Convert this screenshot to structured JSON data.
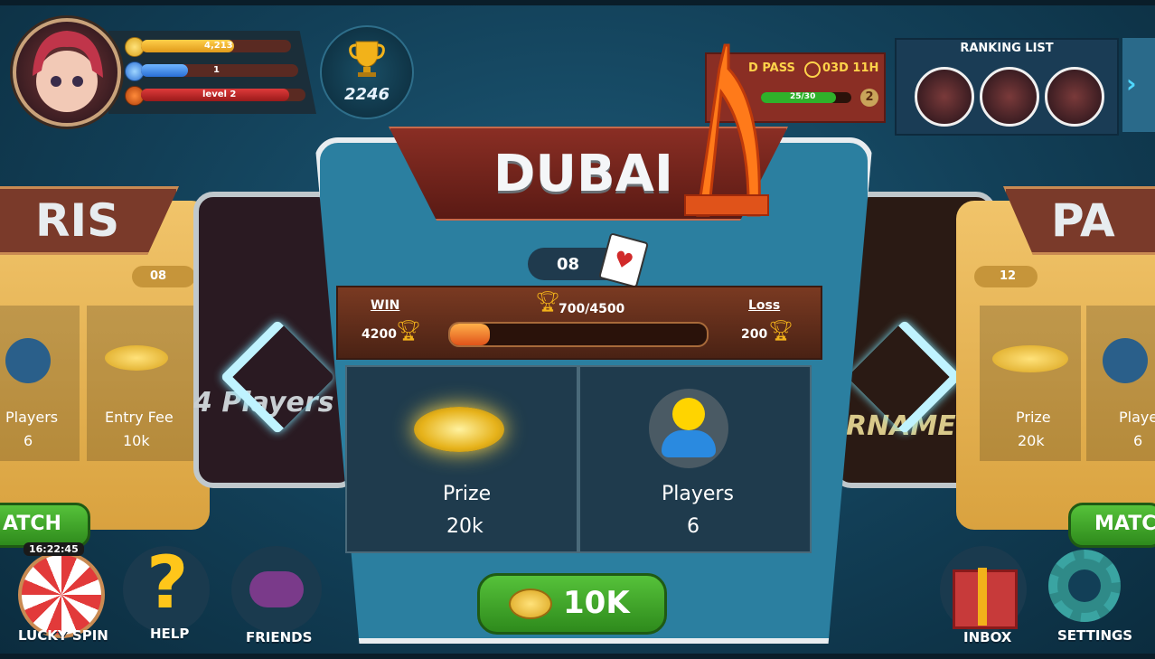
{
  "profile": {
    "coins": "4,213",
    "gems": "1",
    "level": "level 2",
    "trophies": "2246",
    "coin_progress": 0.62,
    "gem_progress": 0.3,
    "level_progress": 0.9
  },
  "pass": {
    "label": "D PASS",
    "timer": "03D 11H",
    "progress_text": "25/30",
    "progress": 0.83,
    "level_badge": "2"
  },
  "ranking": {
    "title": "RANKING LIST",
    "next_icon": "chevron-right-icon"
  },
  "left_card": {
    "title": "RIS",
    "count": "08",
    "players_label": "Players",
    "players_value": "6",
    "entry_label": "Entry Fee",
    "entry_value": "10k",
    "mode_text": "4 Players",
    "button_label": "ATCH"
  },
  "right_card": {
    "title": "PA",
    "count": "12",
    "prize_label": "Prize",
    "prize_value": "20k",
    "players_label": "Player",
    "players_value": "6",
    "mode_text": "RNAMENT",
    "button_label": "MATC"
  },
  "main_card": {
    "city": "DUBAI",
    "count": "08",
    "win_label": "WIN",
    "win_value": "4200",
    "progress_text": "700/4500",
    "progress": 0.1556,
    "loss_label": "Loss",
    "loss_value": "200",
    "prize_label": "Prize",
    "prize_value": "20k",
    "players_label": "Players",
    "players_value": "6",
    "entry_button": "10K"
  },
  "bottom_nav": {
    "lucky_spin_timer": "16:22:45",
    "lucky_spin": "LUCKY SPIN",
    "help": "HELP",
    "friends": "FRIENDS",
    "inbox": "INBOX",
    "settings": "SETTINGS"
  },
  "colors": {
    "accent_green": "#3aa42a",
    "brand_red": "#8a2e24",
    "card_blue": "#2b7fa0"
  }
}
